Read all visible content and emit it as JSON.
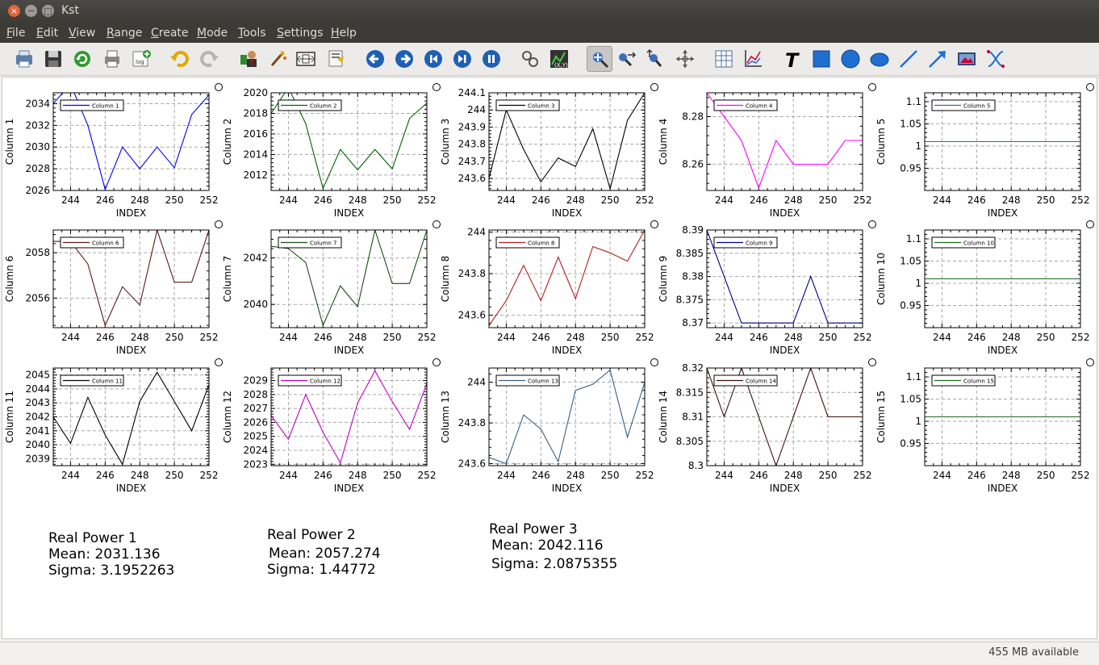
{
  "window": {
    "title": "Kst"
  },
  "menu": [
    "File",
    "Edit",
    "View",
    "Range",
    "Create",
    "Mode",
    "Tools",
    "Settings",
    "Help"
  ],
  "menu_underline": [
    "F",
    "E",
    "V",
    "R",
    "C",
    "M",
    "T",
    "S",
    "H"
  ],
  "toolbar": [
    "print-icon",
    "save-icon",
    "reload-icon",
    "printer-icon",
    "export-image-icon",
    "undo-icon",
    "redo-icon",
    "data-manager-icon",
    "data-wizard-icon",
    "change-data-file-icon",
    "change-dialog-icon",
    "back-icon",
    "forward-icon",
    "first-frame-icon",
    "pause-icon",
    "ruler-icon",
    "xy-plot-icon",
    "zoom-layout-icon",
    "zoom-x-icon",
    "zoom-y-icon",
    "zoom-all-icon",
    "table-icon",
    "line-plot-icon",
    "text-icon",
    "box-icon",
    "circle-icon",
    "ellipse-icon",
    "line-icon",
    "arrow-icon",
    "picture-icon",
    "shared-axis-icon"
  ],
  "status": {
    "memory": "455 MB available"
  },
  "labels": [
    {
      "title": "Real Power 1",
      "mean": "Mean: 2031.136",
      "sigma": "Sigma: 3.1952263"
    },
    {
      "title": "Real Power 2",
      "mean": "Mean: 2057.274",
      "sigma": "Sigma: 1.44772"
    },
    {
      "title": "Real Power 3",
      "mean": "Mean: 2042.116",
      "sigma": "Sigma: 2.0875355"
    }
  ],
  "chart_data": [
    {
      "type": "line",
      "ylabel": "Column 1",
      "xlabel": "INDEX",
      "color": "#0000ff",
      "series": [
        {
          "name": "Column 1",
          "x": [
            243,
            244,
            245,
            246,
            247,
            248,
            249,
            250,
            251,
            252
          ],
          "values": [
            2034,
            2035.8,
            2032,
            2026.1,
            2030,
            2028,
            2030,
            2028.1,
            2033,
            2034.8
          ]
        }
      ],
      "xlim": [
        243,
        252
      ],
      "ylim": [
        2026,
        2035
      ],
      "yticks": [
        2026,
        2028,
        2030,
        2032,
        2034
      ],
      "xticks": [
        244,
        246,
        248,
        250,
        252
      ]
    },
    {
      "type": "line",
      "ylabel": "Column 2",
      "xlabel": "INDEX",
      "color": "#006400",
      "series": [
        {
          "name": "Column 2",
          "x": [
            243,
            244,
            245,
            246,
            247,
            248,
            249,
            250,
            251,
            252
          ],
          "values": [
            2018,
            2020.5,
            2017,
            2010.7,
            2014.5,
            2012.5,
            2014.5,
            2012.6,
            2017.5,
            2019
          ]
        }
      ],
      "xlim": [
        243,
        252
      ],
      "ylim": [
        2010.5,
        2020
      ],
      "yticks": [
        2012,
        2014,
        2016,
        2018,
        2020
      ],
      "xticks": [
        244,
        246,
        248,
        250,
        252
      ]
    },
    {
      "type": "line",
      "ylabel": "Column 3",
      "xlabel": "INDEX",
      "color": "#000000",
      "series": [
        {
          "name": "Column 3",
          "x": [
            243,
            244,
            245,
            246,
            247,
            248,
            249,
            250,
            251,
            252
          ],
          "values": [
            243.6,
            244,
            243.77,
            243.58,
            243.72,
            243.67,
            243.89,
            243.54,
            243.94,
            244.1
          ]
        }
      ],
      "xlim": [
        243,
        252
      ],
      "ylim": [
        243.53,
        244.1
      ],
      "yticks": [
        243.6,
        243.7,
        243.8,
        243.9,
        244,
        244.1
      ],
      "xticks": [
        244,
        246,
        248,
        250,
        252
      ]
    },
    {
      "type": "line",
      "ylabel": "Column 4",
      "xlabel": "INDEX",
      "color": "#ff00ff",
      "series": [
        {
          "name": "Column 4",
          "x": [
            243,
            244,
            245,
            246,
            247,
            248,
            249,
            250,
            251,
            252
          ],
          "values": [
            8.29,
            8.28,
            8.27,
            8.25,
            8.27,
            8.26,
            8.26,
            8.26,
            8.27,
            8.27
          ]
        }
      ],
      "xlim": [
        243,
        252
      ],
      "ylim": [
        8.249,
        8.29
      ],
      "yticks": [
        8.26,
        8.28
      ],
      "xticks": [
        244,
        246,
        248,
        250,
        252
      ]
    },
    {
      "type": "line",
      "ylabel": "Column 5",
      "xlabel": "INDEX",
      "color": "#2e6c8c",
      "series": [
        {
          "name": "Column 5",
          "x": [
            243,
            252
          ],
          "values": [
            1.01,
            1.01
          ]
        }
      ],
      "xlim": [
        243,
        252
      ],
      "ylim": [
        0.9,
        1.12
      ],
      "yticks": [
        0.95,
        1,
        1.05,
        1.1
      ],
      "xticks": [
        244,
        246,
        248,
        250,
        252
      ]
    },
    {
      "type": "line",
      "ylabel": "Column 6",
      "xlabel": "INDEX",
      "color": "#5b1a1a",
      "series": [
        {
          "name": "Column 6",
          "x": [
            243,
            244,
            245,
            246,
            247,
            248,
            249,
            250,
            251,
            252
          ],
          "values": [
            2058.5,
            2058.5,
            2057.5,
            2054.8,
            2056.5,
            2055.7,
            2059,
            2056.7,
            2056.7,
            2059
          ]
        }
      ],
      "xlim": [
        243,
        252
      ],
      "ylim": [
        2054.7,
        2059
      ],
      "yticks": [
        2056,
        2058
      ],
      "xticks": [
        244,
        246,
        248,
        250,
        252
      ]
    },
    {
      "type": "line",
      "ylabel": "Column 7",
      "xlabel": "INDEX",
      "color": "#1c4d1c",
      "series": [
        {
          "name": "Column 7",
          "x": [
            243,
            244,
            245,
            246,
            247,
            248,
            249,
            250,
            251,
            252
          ],
          "values": [
            2042.5,
            2042.4,
            2041.8,
            2039.1,
            2040.8,
            2039.9,
            2043.2,
            2040.9,
            2040.9,
            2043.2
          ]
        }
      ],
      "xlim": [
        243,
        252
      ],
      "ylim": [
        2039,
        2043.2
      ],
      "yticks": [
        2040,
        2042
      ],
      "xticks": [
        244,
        246,
        248,
        250,
        252
      ]
    },
    {
      "type": "line",
      "ylabel": "Column 8",
      "xlabel": "INDEX",
      "color": "#b22222",
      "series": [
        {
          "name": "Column 8",
          "x": [
            243,
            244,
            245,
            246,
            247,
            248,
            249,
            250,
            251,
            252
          ],
          "values": [
            243.55,
            243.67,
            243.84,
            243.67,
            243.88,
            243.68,
            243.93,
            243.9,
            243.86,
            244.01
          ]
        }
      ],
      "xlim": [
        243,
        252
      ],
      "ylim": [
        243.54,
        244.01
      ],
      "yticks": [
        243.6,
        243.8,
        244
      ],
      "xticks": [
        244,
        246,
        248,
        250,
        252
      ]
    },
    {
      "type": "line",
      "ylabel": "Column 9",
      "xlabel": "INDEX",
      "color": "#000080",
      "series": [
        {
          "name": "Column 9",
          "x": [
            243,
            244,
            245,
            246,
            247,
            248,
            249,
            250,
            251,
            252
          ],
          "values": [
            8.39,
            8.38,
            8.37,
            8.37,
            8.37,
            8.37,
            8.38,
            8.37,
            8.37,
            8.37
          ]
        }
      ],
      "xlim": [
        243,
        252
      ],
      "ylim": [
        8.369,
        8.39
      ],
      "yticks": [
        8.37,
        8.375,
        8.38,
        8.385,
        8.39
      ],
      "xticks": [
        244,
        246,
        248,
        250,
        252
      ]
    },
    {
      "type": "line",
      "ylabel": "Column 10",
      "xlabel": "INDEX",
      "color": "#1c6b1c",
      "series": [
        {
          "name": "Column 10",
          "x": [
            243,
            252
          ],
          "values": [
            1.01,
            1.01
          ]
        }
      ],
      "xlim": [
        243,
        252
      ],
      "ylim": [
        0.9,
        1.12
      ],
      "yticks": [
        0.95,
        1,
        1.05,
        1.1
      ],
      "xticks": [
        244,
        246,
        248,
        250,
        252
      ]
    },
    {
      "type": "line",
      "ylabel": "Column 11",
      "xlabel": "INDEX",
      "color": "#000000",
      "series": [
        {
          "name": "Column 11",
          "x": [
            243,
            244,
            245,
            246,
            247,
            248,
            249,
            250,
            251,
            252
          ],
          "values": [
            2042,
            2040.1,
            2043.4,
            2040.7,
            2038.6,
            2043.1,
            2045.2,
            2043.1,
            2041,
            2044.3
          ]
        }
      ],
      "xlim": [
        243,
        252
      ],
      "ylim": [
        2038.5,
        2045.5
      ],
      "yticks": [
        2039,
        2040,
        2041,
        2042,
        2043,
        2044,
        2045
      ],
      "xticks": [
        244,
        246,
        248,
        250,
        252
      ]
    },
    {
      "type": "line",
      "ylabel": "Column 12",
      "xlabel": "INDEX",
      "color": "#c000c0",
      "series": [
        {
          "name": "Column 12",
          "x": [
            243,
            244,
            245,
            246,
            247,
            248,
            249,
            250,
            251,
            252
          ],
          "values": [
            2026.5,
            2024.8,
            2028,
            2025.3,
            2023.1,
            2027.4,
            2029.7,
            2027.5,
            2025.5,
            2028.8
          ]
        }
      ],
      "xlim": [
        243,
        252
      ],
      "ylim": [
        2022.9,
        2029.9
      ],
      "yticks": [
        2023,
        2024,
        2025,
        2026,
        2027,
        2028,
        2029
      ],
      "xticks": [
        244,
        246,
        248,
        250,
        252
      ]
    },
    {
      "type": "line",
      "ylabel": "Column 13",
      "xlabel": "INDEX",
      "color": "#3a5f80",
      "series": [
        {
          "name": "Column 13",
          "x": [
            243,
            244,
            245,
            246,
            247,
            248,
            249,
            250,
            251,
            252
          ],
          "values": [
            243.63,
            243.6,
            243.84,
            243.77,
            243.61,
            243.96,
            243.99,
            244.06,
            243.73,
            244
          ]
        }
      ],
      "xlim": [
        243,
        252
      ],
      "ylim": [
        243.59,
        244.07
      ],
      "yticks": [
        243.6,
        243.8,
        244
      ],
      "xticks": [
        244,
        246,
        248,
        250,
        252
      ]
    },
    {
      "type": "line",
      "ylabel": "Column 14",
      "xlabel": "INDEX",
      "color": "#3d1010",
      "series": [
        {
          "name": "Column 14",
          "x": [
            243,
            244,
            245,
            246,
            247,
            248,
            249,
            250,
            251,
            252
          ],
          "values": [
            8.32,
            8.31,
            8.32,
            8.31,
            8.3,
            8.31,
            8.32,
            8.31,
            8.31,
            8.31
          ]
        }
      ],
      "xlim": [
        243,
        252
      ],
      "ylim": [
        8.3,
        8.32
      ],
      "yticks": [
        8.3,
        8.305,
        8.31,
        8.315,
        8.32
      ],
      "xticks": [
        244,
        246,
        248,
        250,
        252
      ]
    },
    {
      "type": "line",
      "ylabel": "Column 15",
      "xlabel": "INDEX",
      "color": "#1c6b1c",
      "series": [
        {
          "name": "Column 15",
          "x": [
            243,
            252
          ],
          "values": [
            1.01,
            1.01
          ]
        }
      ],
      "xlim": [
        243,
        252
      ],
      "ylim": [
        0.9,
        1.12
      ],
      "yticks": [
        0.95,
        1,
        1.05,
        1.1
      ],
      "xticks": [
        244,
        246,
        248,
        250,
        252
      ]
    }
  ]
}
